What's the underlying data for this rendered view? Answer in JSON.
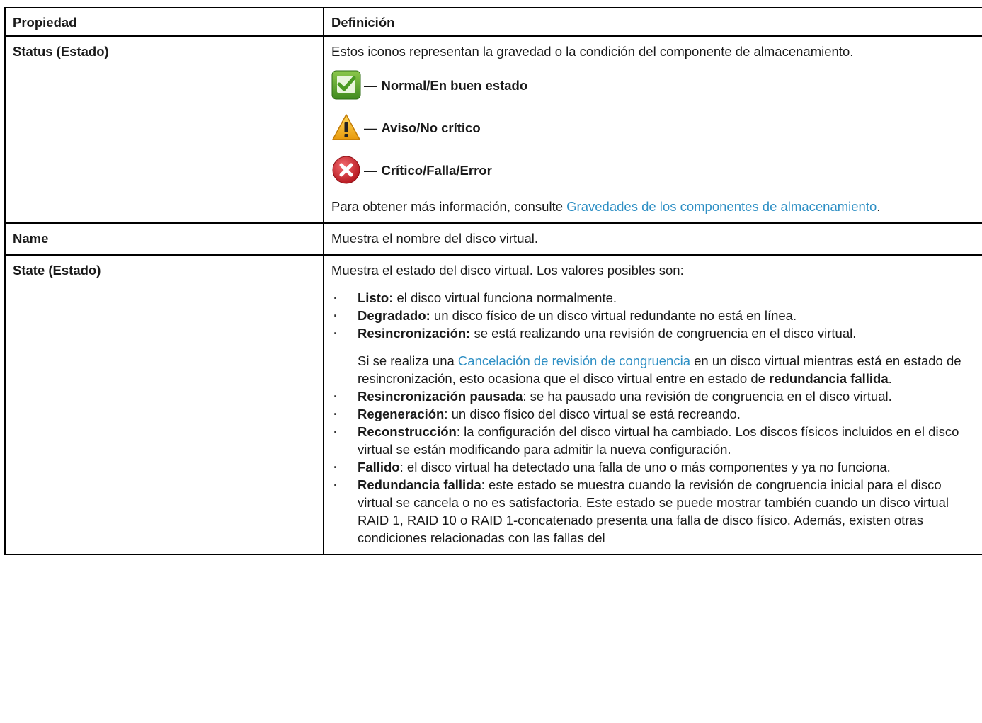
{
  "table": {
    "headers": [
      "Propiedad",
      "Definición"
    ],
    "status_row": {
      "property": "Status (Estado)",
      "intro": "Estos iconos representan la gravedad o la condición del componente de almacenamiento.",
      "icons": [
        {
          "icon": "check-icon",
          "color": "#5aa02c",
          "dash": "—",
          "label": "Normal/En buen estado"
        },
        {
          "icon": "warning-icon",
          "color": "#f0b41c",
          "dash": "—",
          "label": "Aviso/No crítico"
        },
        {
          "icon": "error-icon",
          "color": "#d8262e",
          "dash": "—",
          "label": "Crítico/Falla/Error"
        }
      ],
      "more_info_prefix": "Para obtener más información, consulte ",
      "more_info_link": "Gravedades de los componentes de almacenamiento",
      "more_info_suffix": "."
    },
    "name_row": {
      "property": "Name",
      "definition": "Muestra el nombre del disco virtual."
    },
    "state_row": {
      "property": "State (Estado)",
      "intro": "Muestra el estado del disco virtual. Los valores posibles son:",
      "items": [
        {
          "term": "Listo:",
          "text": " el disco virtual funciona normalmente."
        },
        {
          "term": "Degradado:",
          "text": " un disco físico de un disco virtual redundante no está en línea."
        },
        {
          "term": "Resincronización:",
          "text": " se está realizando una revisión de congruencia en el disco virtual."
        }
      ],
      "sub_paragraph": {
        "prefix": "Si se realiza una ",
        "link": "Cancelación de revisión de congruencia",
        "middle": " en un disco virtual mientras está en estado de resincronización, esto ocasiona que el disco virtual entre en estado de ",
        "bold": "redundancia fallida",
        "suffix": "."
      },
      "items2": [
        {
          "term": "Resincronización pausada",
          "text": ": se ha pausado una revisión de congruencia en el disco virtual."
        },
        {
          "term": "Regeneración",
          "text": ": un disco físico del disco virtual se está recreando."
        },
        {
          "term": "Reconstrucción",
          "text": ": la configuración del disco virtual ha cambiado. Los discos físicos incluidos en el disco virtual se están modificando para admitir la nueva configuración."
        },
        {
          "term": "Fallido",
          "text": ": el disco virtual ha detectado una falla de uno o más componentes y ya no funciona."
        },
        {
          "term": "Redundancia fallida",
          "text": ": este estado se muestra cuando la revisión de congruencia inicial para el disco virtual se cancela o no es satisfactoria. Este estado se puede mostrar también cuando un disco virtual RAID 1, RAID 10 o RAID 1-concatenado presenta una falla de disco físico. Además, existen otras condiciones relacionadas con las fallas del"
        }
      ]
    }
  }
}
